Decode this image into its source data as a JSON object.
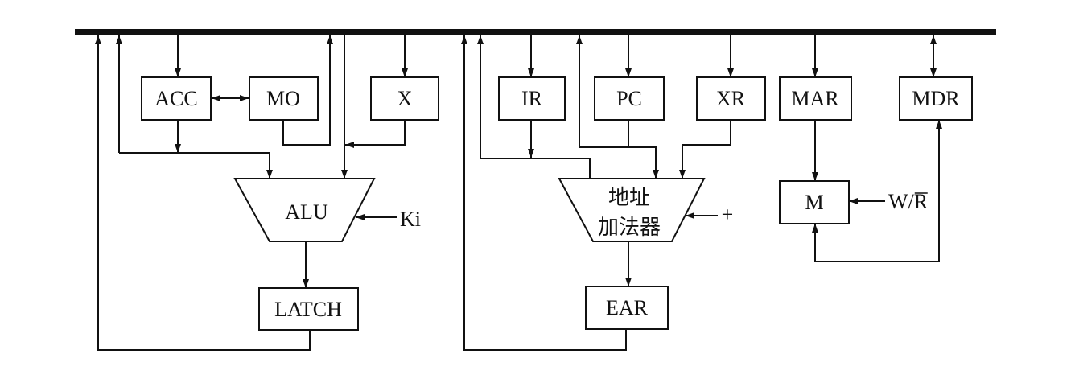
{
  "diagram": {
    "registers": {
      "acc": "ACC",
      "mo": "MO",
      "x": "X",
      "ir": "IR",
      "pc": "PC",
      "xr": "XR",
      "mar": "MAR",
      "mdr": "MDR"
    },
    "alu": "ALU",
    "latch": "LATCH",
    "address_adder": {
      "line1": "地址",
      "line2": "加法器"
    },
    "ear": "EAR",
    "memory": "M",
    "control_inputs": {
      "ki": "Ki",
      "plus": "+",
      "write_read_prefix": "W/",
      "write_read_overbar": "R"
    }
  },
  "colors": {
    "line": "#111111",
    "background": "#ffffff"
  }
}
